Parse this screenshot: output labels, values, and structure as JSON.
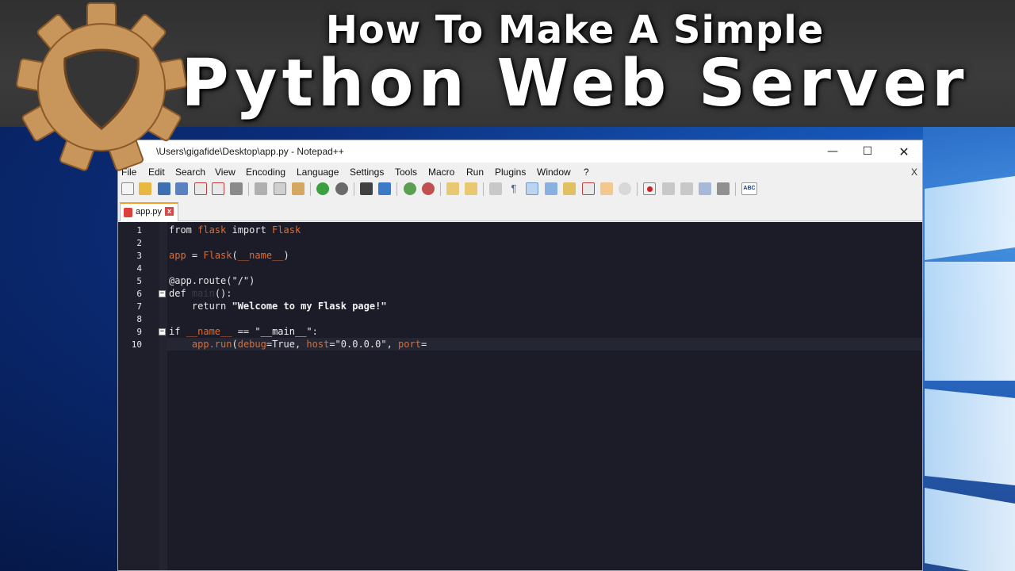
{
  "banner": {
    "line1": "How To Make A Simple",
    "line2": "Python Web Server"
  },
  "window": {
    "title": "\\Users\\gigafide\\Desktop\\app.py - Notepad++",
    "minimize": "—",
    "maximize": "☐",
    "close": "✕"
  },
  "menu": {
    "items": [
      "File",
      "Edit",
      "Search",
      "View",
      "Encoding",
      "Language",
      "Settings",
      "Tools",
      "Macro",
      "Run",
      "Plugins",
      "Window",
      "?"
    ],
    "close_doc": "X"
  },
  "tabs": [
    {
      "label": "app.py",
      "close": "x"
    }
  ],
  "editor": {
    "line_numbers": [
      "1",
      "2",
      "3",
      "4",
      "5",
      "6",
      "7",
      "8",
      "9",
      "10"
    ],
    "lines": [
      {
        "kw": "from ",
        "mod": "flask",
        "kw2": " import ",
        "mod2": "Flask"
      },
      {},
      {
        "a": "app",
        "b": " = ",
        "c": "Flask",
        "d": "(",
        "e": "__name__",
        "f": ")"
      },
      {},
      {
        "a": "@app.route(\"/\")"
      },
      {
        "a": "def ",
        "b": "main",
        "c": "():"
      },
      {
        "a": "    return ",
        "b": "\"Welcome to my Flask page!\""
      },
      {},
      {
        "a": "if ",
        "b": "__name__",
        "c": " == ",
        "d": "\"__main__\"",
        "e": ":"
      },
      {
        "a": "    ",
        "b": "app.run",
        "c": "(",
        "d": "debug",
        "e": "=True, ",
        "f": "host",
        "g": "=\"0.0.0.0\", ",
        "h": "port",
        "i": "="
      }
    ]
  },
  "colors": {
    "editor_bg": "#1b1c28",
    "keyword_orange": "#e06c2e",
    "tab_accent": "#f0a030",
    "logo_cardboard": "#c8955a"
  }
}
